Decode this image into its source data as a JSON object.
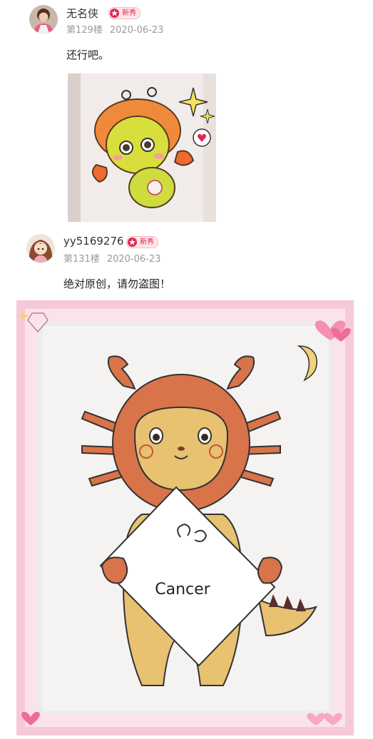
{
  "posts": [
    {
      "username": "无名侠",
      "badge": "新秀",
      "floor": "第129楼",
      "date": "2020-06-23",
      "content": "还行吧。",
      "image_desc_icon": "cartoon-cancer-crab-drawing"
    },
    {
      "username": "yy5169276",
      "badge": "新秀",
      "floor": "第131楼",
      "date": "2020-06-23",
      "content": "绝对原创，请勿盗图！",
      "image_text": "Cancer"
    }
  ],
  "colors": {
    "badge_red": "#e4264b",
    "meta_gray": "#9a9a9a",
    "frame_pink": "#f7c9d6",
    "crab_orange": "#d8734a",
    "body_yellow": "#e8c171"
  }
}
